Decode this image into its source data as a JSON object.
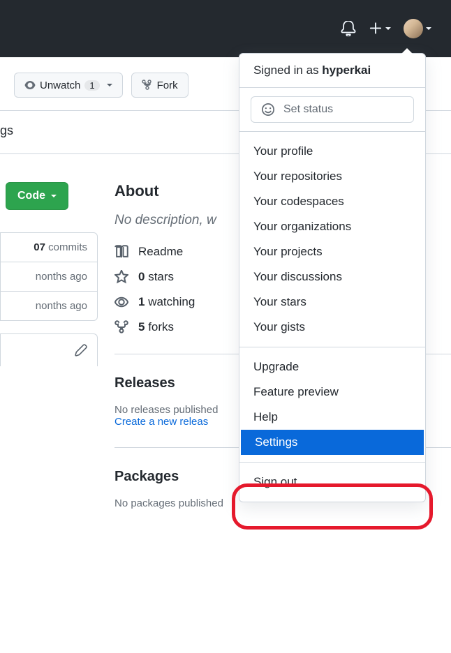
{
  "topbar": {
    "notifications_icon": "bell-icon",
    "add_icon": "plus-icon",
    "avatar_alt": "user avatar"
  },
  "actions": {
    "unwatch_label": "Unwatch",
    "unwatch_count": "1",
    "fork_label": "Fork"
  },
  "crumbs_fragment": "gs",
  "code_label": "Code",
  "commits": {
    "count_fragment": "07",
    "label": "commits",
    "row1_time": "nonths ago",
    "row2_time": "nonths ago"
  },
  "about": {
    "heading": "About",
    "description_fragment": "No description, w",
    "readme": "Readme",
    "stars_count": "0",
    "stars_label": "stars",
    "watching_count": "1",
    "watching_label": "watching",
    "forks_count": "5",
    "forks_label": "forks"
  },
  "releases": {
    "heading": "Releases",
    "none_fragment": "No releases published",
    "create_fragment": "Create a new releas"
  },
  "packages": {
    "heading": "Packages",
    "none": "No packages published"
  },
  "dropdown": {
    "signed_in_prefix": "Signed in as ",
    "username": "hyperkai",
    "set_status": "Set status",
    "group1": [
      "Your profile",
      "Your repositories",
      "Your codespaces",
      "Your organizations",
      "Your projects",
      "Your discussions",
      "Your stars",
      "Your gists"
    ],
    "group2": [
      "Upgrade",
      "Feature preview",
      "Help",
      "Settings"
    ],
    "highlighted_index": 3,
    "signout": "Sign out"
  }
}
